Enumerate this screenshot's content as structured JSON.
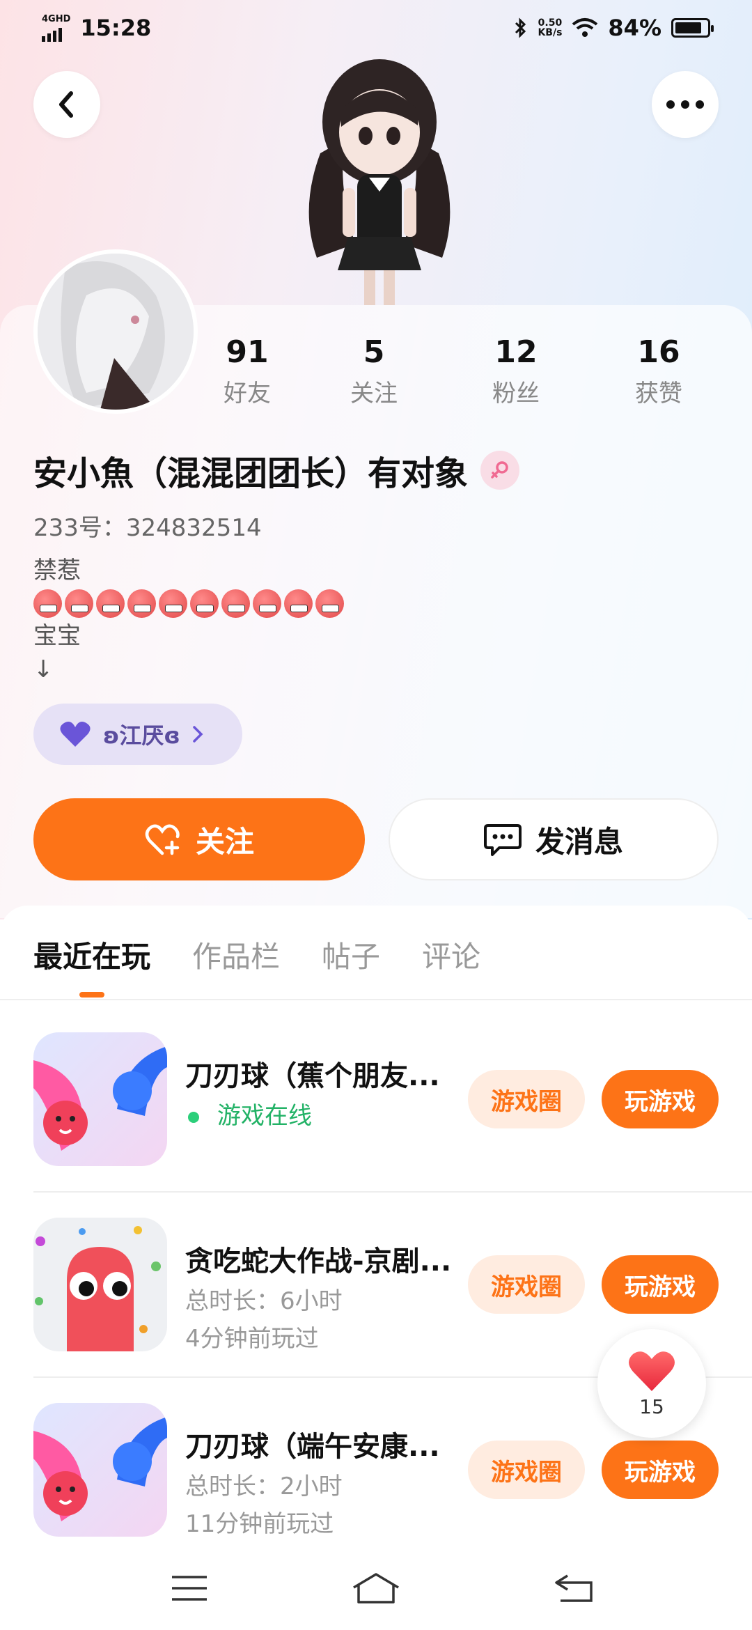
{
  "status_bar": {
    "network": "4GHD",
    "time": "15:28",
    "speed_value": "0.50",
    "speed_unit": "KB/s",
    "battery": "84%"
  },
  "stats": [
    {
      "value": "91",
      "label": "好友"
    },
    {
      "value": "5",
      "label": "关注"
    },
    {
      "value": "12",
      "label": "粉丝"
    },
    {
      "value": "16",
      "label": "获赞"
    }
  ],
  "profile": {
    "name": "安小魚（混混团团长）有对象",
    "id_line": "233号：324832514",
    "bio_line1": "禁惹",
    "bio_line3": "宝宝",
    "bio_line4": "↓",
    "couple_label": "ʚ江厌ɞ"
  },
  "actions": {
    "follow_label": "关注",
    "message_label": "发消息"
  },
  "tabs": [
    {
      "label": "最近在玩",
      "active": true
    },
    {
      "label": "作品栏",
      "active": false
    },
    {
      "label": "帖子",
      "active": false
    },
    {
      "label": "评论",
      "active": false
    }
  ],
  "games": [
    {
      "title": "刀刃球（蕉个朋友...",
      "sub1": "游戏在线",
      "sub2": "",
      "circle_label": "游戏圈",
      "play_label": "玩游戏"
    },
    {
      "title": "贪吃蛇大作战-京剧...",
      "sub1": "总时长：6小时",
      "sub2": "4分钟前玩过",
      "circle_label": "游戏圈",
      "play_label": "玩游戏"
    },
    {
      "title": "刀刃球（端午安康...",
      "sub1": "总时长：2小时",
      "sub2": "11分钟前玩过",
      "circle_label": "游戏圈",
      "play_label": "玩游戏"
    }
  ],
  "like_float": {
    "count": "15"
  },
  "colors": {
    "accent": "#fd7317",
    "online": "#22b266",
    "couple_pill": "#e6e1f6"
  },
  "icons": [
    "back-arrow-icon",
    "more-dots-icon",
    "female-icon",
    "heart-icon",
    "heart-plus-icon",
    "chat-bubble-icon",
    "menu-icon",
    "home-icon",
    "back-icon"
  ]
}
